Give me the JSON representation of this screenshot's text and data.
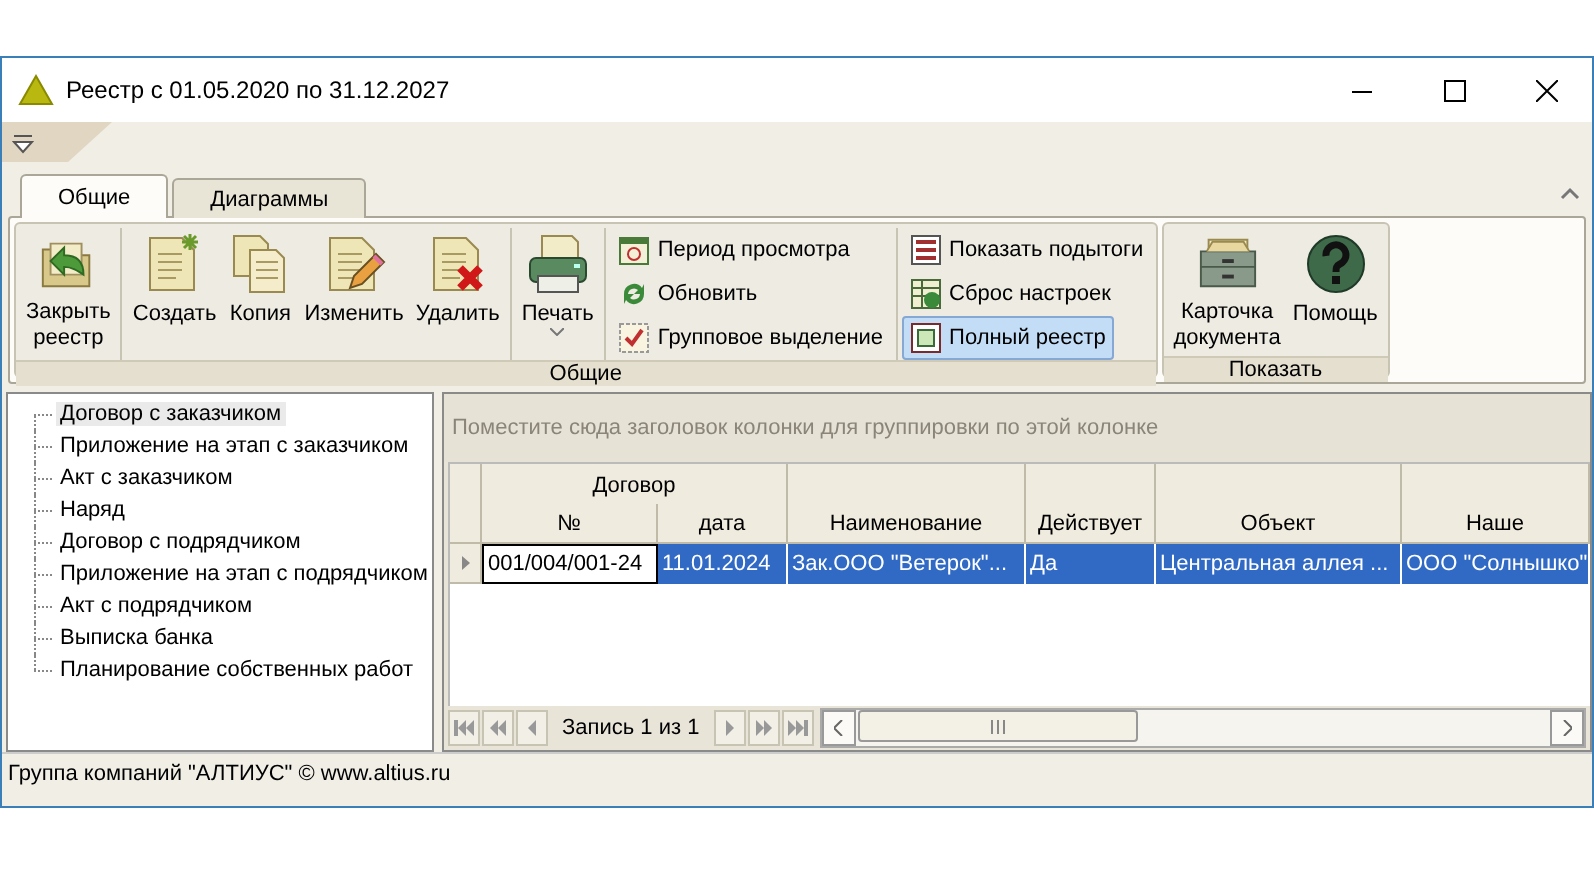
{
  "window": {
    "title": "Реестр с 01.05.2020 по 31.12.2027"
  },
  "ribbon": {
    "tabs": [
      {
        "label": "Общие",
        "selected": true
      },
      {
        "label": "Диаграммы",
        "selected": false
      }
    ],
    "groups": [
      {
        "title": "Общие",
        "sections": [
          {
            "kind": "large",
            "buttons": [
              {
                "label": "Закрыть реестр"
              }
            ]
          },
          {
            "kind": "large",
            "buttons": [
              {
                "label": "Создать"
              },
              {
                "label": "Копия"
              },
              {
                "label": "Изменить"
              },
              {
                "label": "Удалить"
              }
            ]
          },
          {
            "kind": "dropdown",
            "buttons": [
              {
                "label": "Печать"
              }
            ]
          },
          {
            "kind": "small",
            "buttons": [
              {
                "label": "Период просмотра",
                "selected": false
              },
              {
                "label": "Обновить",
                "selected": false
              },
              {
                "label": "Групповое выделение",
                "selected": false
              }
            ]
          },
          {
            "kind": "small",
            "buttons": [
              {
                "label": "Показать подытоги",
                "selected": false
              },
              {
                "label": "Сброс настроек",
                "selected": false
              },
              {
                "label": "Полный реестр",
                "selected": true
              }
            ]
          }
        ]
      },
      {
        "title": "Показать",
        "sections": [
          {
            "kind": "large",
            "buttons": [
              {
                "label": "Карточка документа"
              },
              {
                "label": "Помощь"
              }
            ]
          }
        ]
      }
    ]
  },
  "tree": {
    "items": [
      {
        "label": "Договор с заказчиком",
        "selected": true
      },
      {
        "label": "Приложение на этап с заказчиком",
        "selected": false
      },
      {
        "label": "Акт с заказчиком",
        "selected": false
      },
      {
        "label": "Наряд",
        "selected": false
      },
      {
        "label": "Договор с подрядчиком",
        "selected": false
      },
      {
        "label": "Приложение на этап с подрядчиком",
        "selected": false
      },
      {
        "label": "Акт с подрядчиком",
        "selected": false
      },
      {
        "label": "Выписка банка",
        "selected": false
      },
      {
        "label": "Планирование собственных работ",
        "selected": false
      }
    ]
  },
  "grid": {
    "group_panel": {
      "placeholder": "Поместите сюда заголовок колонки для группировки по этой колонке"
    },
    "bands": [
      {
        "label": "Договор"
      }
    ],
    "columns": [
      "№",
      "дата",
      "Наименование",
      "Действует",
      "Объект",
      "Наше"
    ],
    "rows": [
      {
        "selected": true,
        "cells": [
          "001/004/001-24",
          "11.01.2024",
          "Зак.ООО \"Ветерок\"...",
          "Да",
          "Центральная аллея ...",
          "ООО \"Солнышко\""
        ]
      }
    ],
    "navigator": {
      "text": "Запись 1 из 1"
    }
  },
  "status_bar": {
    "text": "Группа компаний \"АЛТИУС\" © www.altius.ru"
  }
}
